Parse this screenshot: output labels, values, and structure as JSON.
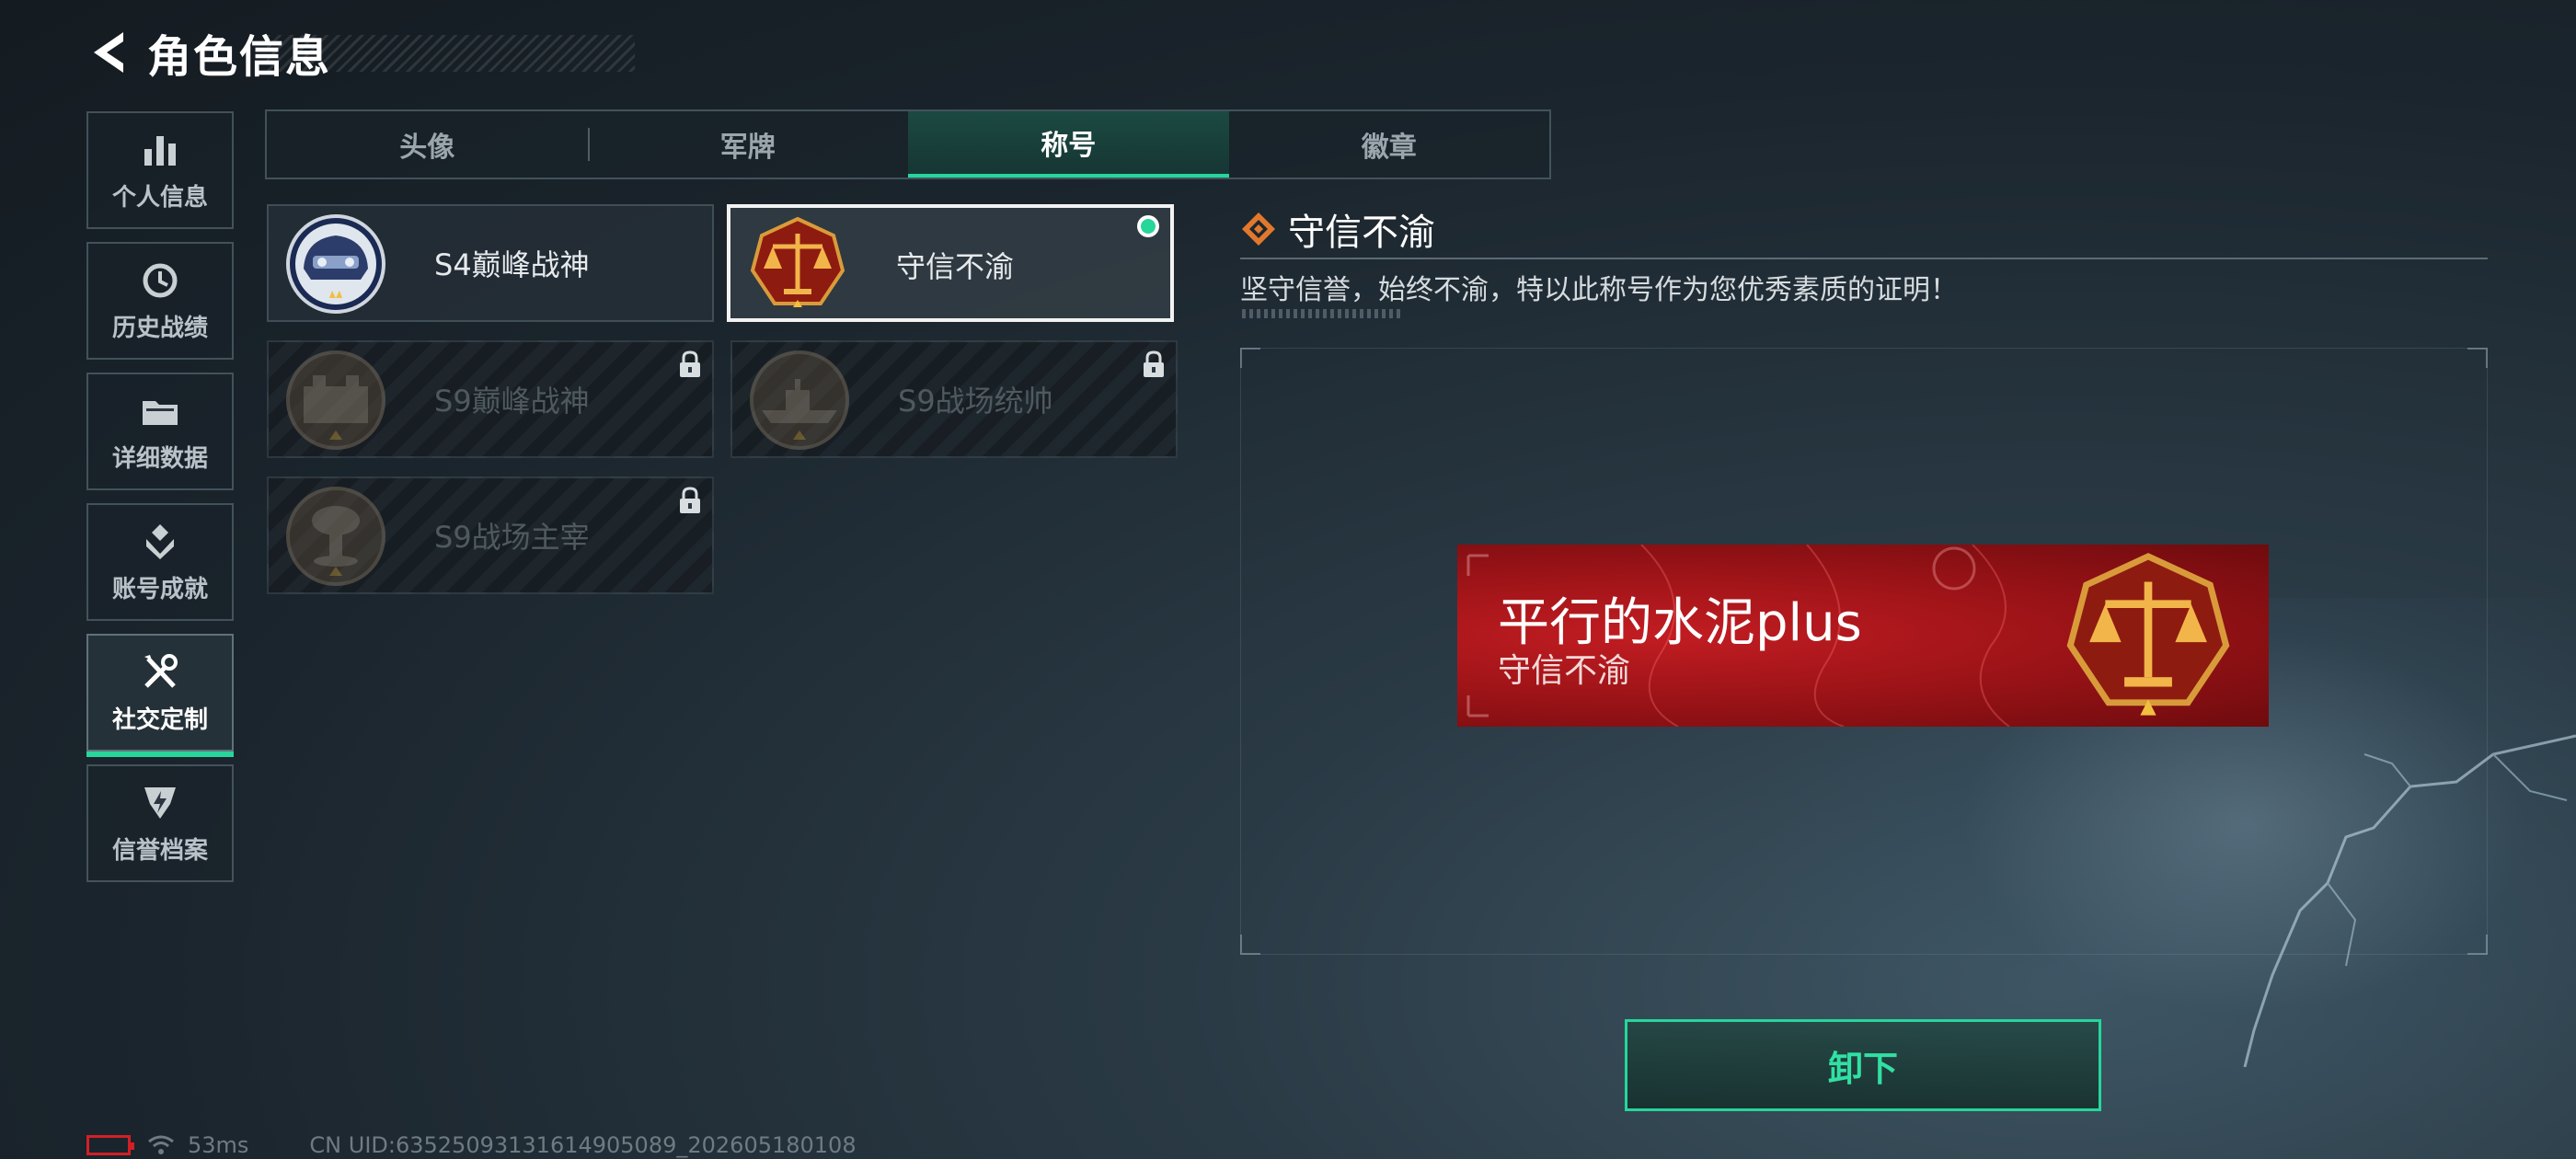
{
  "header": {
    "title": "角色信息",
    "back_icon": "back-arrow-icon"
  },
  "sidebar": {
    "items": [
      {
        "label": "个人信息",
        "icon": "bar-chart-icon",
        "active": false
      },
      {
        "label": "历史战绩",
        "icon": "history-clock-icon",
        "active": false
      },
      {
        "label": "详细数据",
        "icon": "folder-icon",
        "active": false
      },
      {
        "label": "账号成就",
        "icon": "achievement-icon",
        "active": false
      },
      {
        "label": "社交定制",
        "icon": "tools-icon",
        "active": true
      },
      {
        "label": "信誉档案",
        "icon": "shield-emblem-icon",
        "active": false
      }
    ]
  },
  "tabs": [
    {
      "label": "头像",
      "active": false
    },
    {
      "label": "军牌",
      "active": false
    },
    {
      "label": "称号",
      "active": true
    },
    {
      "label": "徽章",
      "active": false
    }
  ],
  "titles": [
    {
      "label": "S4巅峰战神",
      "medal": "helmet-medal-icon",
      "locked": false,
      "selected": false
    },
    {
      "label": "守信不渝",
      "medal": "scales-medal-icon",
      "locked": false,
      "selected": true,
      "equipped": true
    },
    {
      "label": "S9巅峰战神",
      "medal": "fortress-medal-icon",
      "locked": true,
      "selected": false
    },
    {
      "label": "S9战场统帅",
      "medal": "warship-medal-icon",
      "locked": true,
      "selected": false
    },
    {
      "label": "S9战场主宰",
      "medal": "mushroom-cloud-medal-icon",
      "locked": true,
      "selected": false
    }
  ],
  "detail": {
    "title": "守信不渝",
    "description": "坚守信誉，始终不渝，特以此称号作为您优秀素质的证明！"
  },
  "nameplate": {
    "player_name": "平行的水泥plus",
    "title": "守信不渝",
    "background_color": "#b5171c"
  },
  "actions": {
    "unequip_label": "卸下"
  },
  "status_bar": {
    "ping": "53ms",
    "uid": "CN UID:63525093131614905089_202605180108",
    "battery_color": "#d21f26"
  },
  "colors": {
    "accent": "#27d69a",
    "locked_text": "#4f5a60"
  }
}
